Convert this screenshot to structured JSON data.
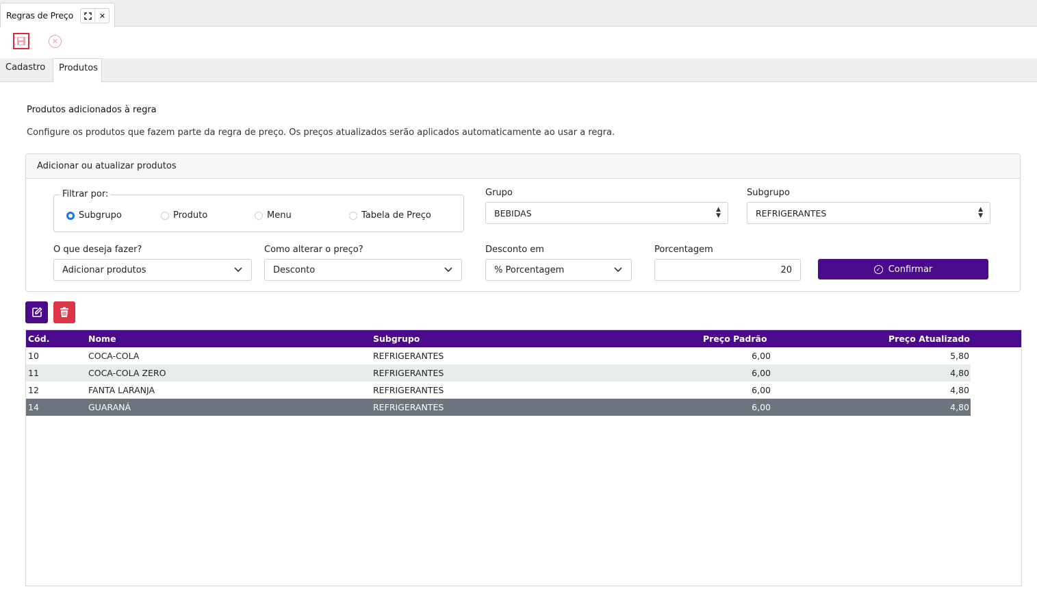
{
  "window": {
    "tab_title": "Regras de Preço",
    "expand_icon": "expand-icon",
    "close_icon": "close-icon",
    "close_glyph": "✕",
    "expand_glyph": "⛶"
  },
  "toolbar": {
    "save_icon": "floppy-disk-icon",
    "cancel_icon": "cancel-circle-icon",
    "cancel_glyph": "✕"
  },
  "tabs": [
    {
      "label": "Cadastro"
    },
    {
      "label": "Produtos"
    }
  ],
  "section": {
    "title": "Produtos adicionados à regra",
    "description": "Configure os produtos que fazem parte da regra de preço. Os preços atualizados serão aplicados automaticamente ao usar a regra."
  },
  "panel": {
    "title": "Adicionar ou atualizar produtos",
    "filter_legend": "Filtrar por:",
    "filter_options": [
      "Subgrupo",
      "Produto",
      "Menu",
      "Tabela de Preço"
    ],
    "filter_selected": "Subgrupo",
    "grupo_label": "Grupo",
    "grupo_value": "BEBIDAS",
    "subgrupo_label": "Subgrupo",
    "subgrupo_value": "REFRIGERANTES",
    "acao_label": "O que deseja fazer?",
    "acao_value": "Adicionar produtos",
    "alterar_label": "Como alterar o preço?",
    "alterar_value": "Desconto",
    "desconto_label": "Desconto em",
    "desconto_value": "% Porcentagem",
    "porcentagem_label": "Porcentagem",
    "porcentagem_value": "20",
    "confirm_label": "Confirmar"
  },
  "actions": {
    "edit_icon": "edit-icon",
    "delete_icon": "trash-icon"
  },
  "grid": {
    "columns": [
      "Cód.",
      "Nome",
      "Subgrupo",
      "Preço Padrão",
      "Preço Atualizado"
    ],
    "rows": [
      {
        "cod": "10",
        "nome": "COCA-COLA",
        "subgrupo": "REFRIGERANTES",
        "padrao": "6,00",
        "atualizado": "5,80"
      },
      {
        "cod": "11",
        "nome": "COCA-COLA ZERO",
        "subgrupo": "REFRIGERANTES",
        "padrao": "6,00",
        "atualizado": "4,80"
      },
      {
        "cod": "12",
        "nome": "FANTA LARANJA",
        "subgrupo": "REFRIGERANTES",
        "padrao": "6,00",
        "atualizado": "4,80"
      },
      {
        "cod": "14",
        "nome": "GUARANÁ",
        "subgrupo": "REFRIGERANTES",
        "padrao": "6,00",
        "atualizado": "4,80"
      }
    ],
    "selected_row": 3
  },
  "colors": {
    "primary": "#4b0a8c",
    "danger": "#dc3545",
    "selected_row": "#6c757d",
    "alt_row": "#e9ecec",
    "radio_active": "#1a73e8"
  }
}
